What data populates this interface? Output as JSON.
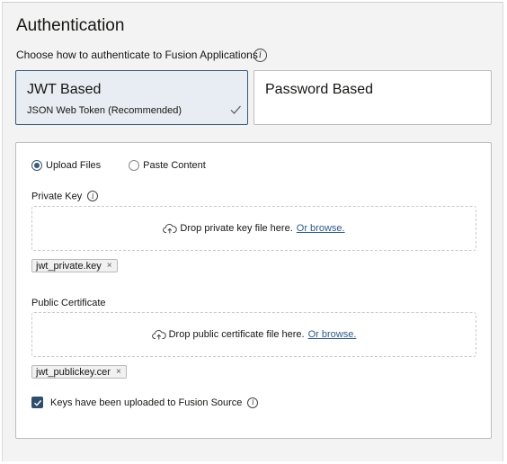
{
  "auth": {
    "title": "Authentication",
    "subtitle": "Choose how to authenticate to Fusion Applications",
    "info_glyph": "i"
  },
  "methods": [
    {
      "title": "JWT Based",
      "subtitle": "JSON Web Token (Recommended)",
      "selected": true
    },
    {
      "title": "Password Based",
      "selected": false
    }
  ],
  "form": {
    "radios": [
      {
        "label": "Upload Files",
        "checked": true
      },
      {
        "label": "Paste Content",
        "checked": false
      }
    ],
    "private_key": {
      "label": "Private Key",
      "drop_text": "Drop private key file here.",
      "browse_text": "Or browse.",
      "file": "jwt_private.key"
    },
    "public_cert": {
      "label": "Public Certificate",
      "drop_text": "Drop public certificate file here.",
      "browse_text": "Or browse.",
      "file": "jwt_publickey.cer"
    },
    "confirm": {
      "label": "Keys have been uploaded to Fusion Source",
      "checked": true
    },
    "remove_glyph": "×"
  },
  "icons": [
    "info-icon",
    "check-icon",
    "upload-cloud-icon",
    "close-icon",
    "checkbox-check-icon"
  ],
  "colors": {
    "accent": "#3a5a78",
    "link": "#2e5a87",
    "selected_bg": "#e7edf2"
  }
}
